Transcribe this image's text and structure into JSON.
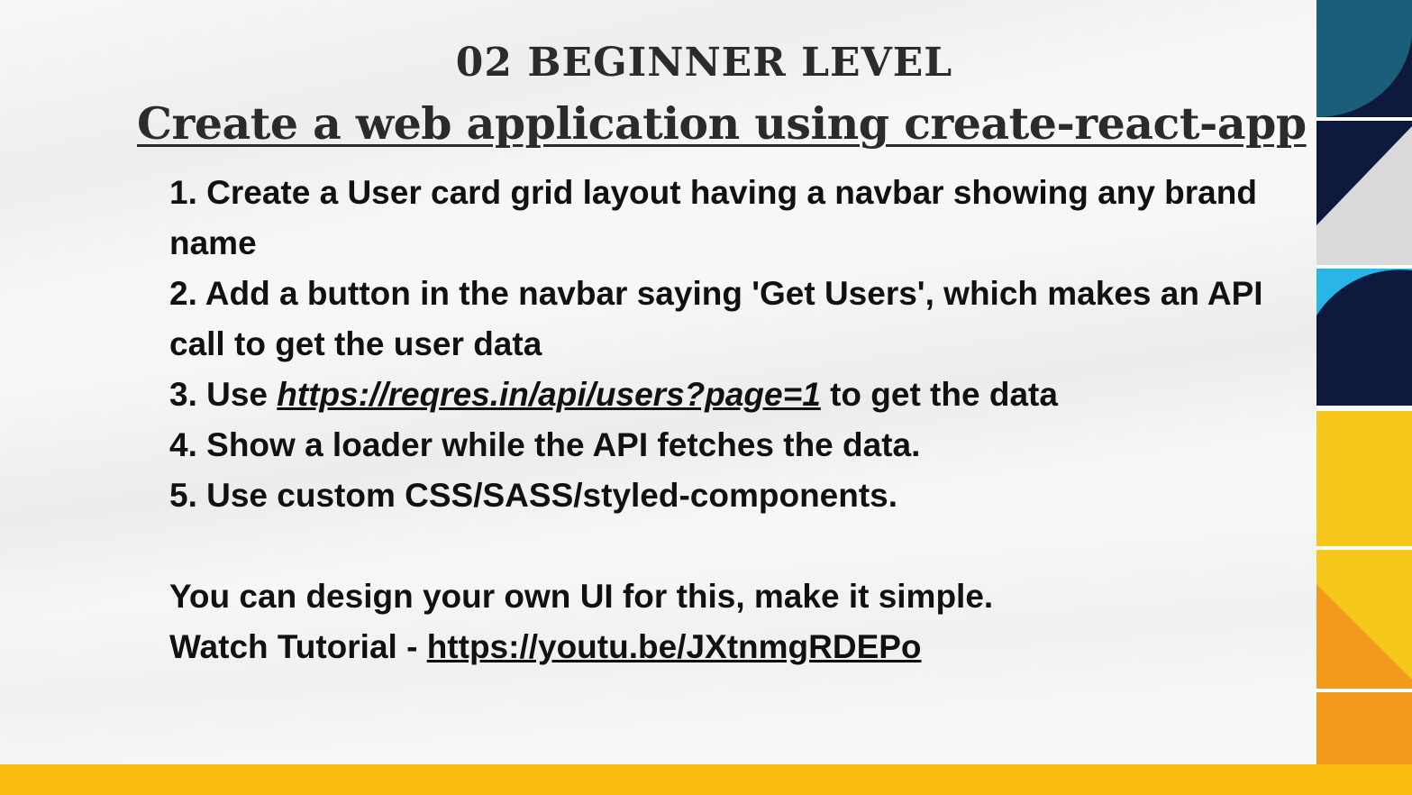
{
  "slide": {
    "heading": "02 BEGINNER LEVEL",
    "subheading": " Create a web application using create-react-app",
    "steps": [
      {
        "text": "1. Create a User card grid layout having a navbar showing any brand name"
      },
      {
        "text": "2. Add a button in the navbar saying 'Get Users', which makes an API call to get the user data"
      },
      {
        "prefix": "3. Use ",
        "link": "https://reqres.in/api/users?page=1",
        "suffix": " to get the data"
      },
      {
        "text": "4. Show a loader while the API fetches the data."
      },
      {
        "text": "5. Use custom CSS/SASS/styled-components."
      }
    ],
    "note": "You can design your own UI for this, make it simple.",
    "tutorial_prefix": "Watch Tutorial - ",
    "tutorial_link": "https://youtu.be/JXtnmgRDEPo"
  },
  "colors": {
    "accent_yellow": "#f9bb10",
    "navy": "#0e1a3d",
    "teal": "#1b5e7a",
    "sky": "#29b6e6",
    "orange": "#f39a1b",
    "text": "#111111"
  }
}
